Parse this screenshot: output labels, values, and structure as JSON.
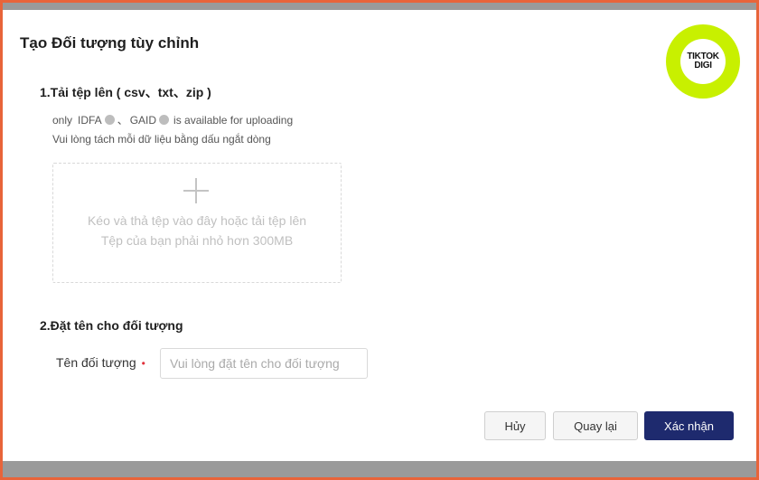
{
  "dialog": {
    "title": "Tạo Đối tượng tùy chỉnh"
  },
  "logo": {
    "line1": "TIKTOK",
    "line2": "DIGI",
    "color": "#c8f000"
  },
  "upload_section": {
    "heading": "1.Tải tệp lên ( csv、txt、zip )",
    "hint_prefix": "only",
    "hint_idfa": "IDFA",
    "hint_sep": "、",
    "hint_gaid": "GAID",
    "hint_suffix": "is available for uploading",
    "hint_line2": "Vui lòng tách mỗi dữ liệu bằng dấu ngắt dòng",
    "dropzone_text": "Kéo và thả tệp vào đây hoặc tải tệp lên",
    "dropzone_limit": "Tệp của bạn phải nhỏ hơn 300MB"
  },
  "name_section": {
    "heading": "2.Đặt tên cho đối tượng",
    "field_label": "Tên đối tượng",
    "required_mark": "•",
    "placeholder": "Vui lòng đặt tên cho đối tượng",
    "value": ""
  },
  "footer": {
    "cancel_label": "Hủy",
    "back_label": "Quay lại",
    "confirm_label": "Xác nhận"
  },
  "colors": {
    "border": "#e8643a",
    "primary": "#1e2a6e",
    "required": "#e0303a"
  }
}
